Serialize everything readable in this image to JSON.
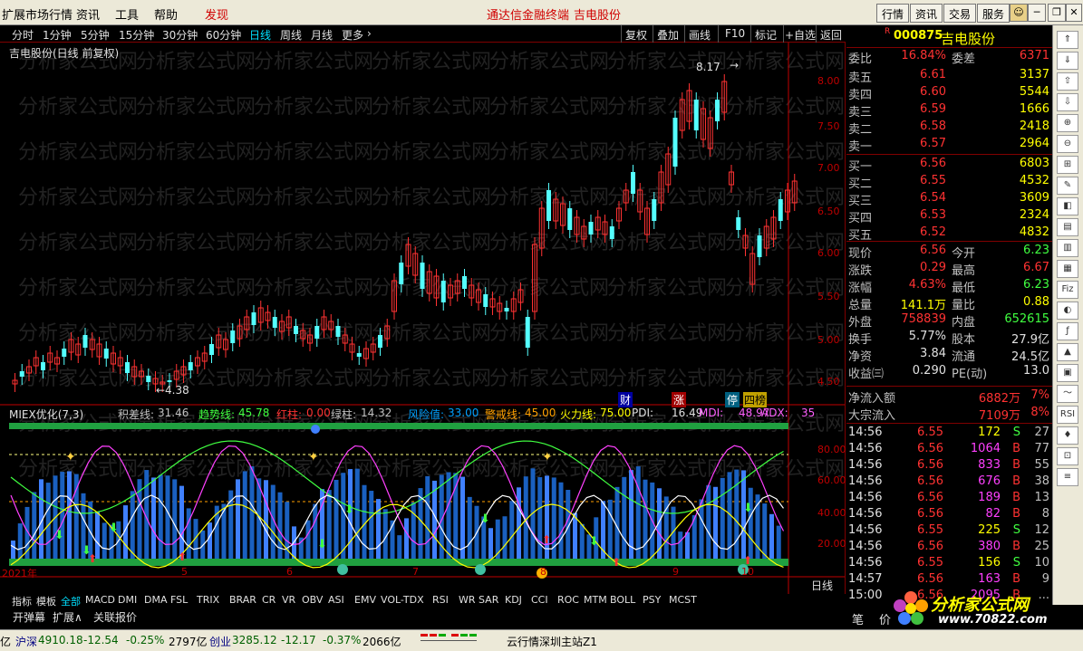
{
  "menu": {
    "items": [
      "扩展市场行情",
      "资讯",
      "工具",
      "帮助",
      "发现"
    ],
    "center": [
      "通达信金融终端",
      "吉电股份"
    ],
    "right_buttons": [
      "行情",
      "资讯",
      "交易",
      "服务"
    ]
  },
  "periods": [
    "分时",
    "1分钟",
    "5分钟",
    "15分钟",
    "30分钟",
    "60分钟",
    "日线",
    "周线",
    "月线",
    "更多"
  ],
  "tools": [
    "复权",
    "叠加",
    "画线",
    "F10",
    "标记",
    "+自选",
    "返回"
  ],
  "chart_title": "吉电股份(日线 前复权)",
  "price_axis": [
    "8.00",
    "7.50",
    "7.00",
    "6.50",
    "6.00",
    "5.50",
    "5.00",
    "4.50"
  ],
  "high_label": "8.17",
  "low_label": "4.38",
  "event_badges": [
    "财",
    "涨",
    "停",
    "四榜"
  ],
  "indicator": {
    "name": "MIEX优化(7,3)",
    "params": [
      {
        "label": "积差线:",
        "value": "31.46"
      },
      {
        "label": "趋势线:",
        "value": "45.78"
      },
      {
        "label": "红柱:",
        "value": "0.00"
      },
      {
        "label": "绿柱:",
        "value": "14.32"
      },
      {
        "label": "风险值:",
        "value": "33.00"
      },
      {
        "label": "警戒线:",
        "value": "45.00"
      },
      {
        "label": "火力线:",
        "value": "75.00"
      },
      {
        "label": "PDI:",
        "value": "16.49"
      },
      {
        "label": "MDI:",
        "value": "48.97"
      },
      {
        "label": "ADX:",
        "value": "35"
      }
    ],
    "axis": [
      "80.00",
      "60.00",
      "40.00",
      "20.00"
    ]
  },
  "date_axis": [
    "2021年",
    "5",
    "6",
    "7",
    "8",
    "9",
    "10"
  ],
  "period_label": "日线",
  "zoom": [
    "+",
    "-",
    "0"
  ],
  "indicator_tabs": [
    "指标",
    "模板",
    "全部",
    "MACD",
    "DMI",
    "DMA",
    "FSL",
    "TRIX",
    "BRAR",
    "CR",
    "VR",
    "OBV",
    "ASI",
    "EMV",
    "VOL-TDX",
    "RSI",
    "WR",
    "SAR",
    "KDJ",
    "CCI",
    "ROC",
    "MTM",
    "BOLL",
    "PSY",
    "MCST"
  ],
  "sub_tabs": [
    "开弹幕",
    "扩展∧",
    "关联报价"
  ],
  "quote": {
    "code": "000875",
    "name": "吉电股份",
    "webi_label": "委比",
    "webi": "16.84%",
    "weicha_label": "委差",
    "weicha": "6371",
    "sells": [
      {
        "l": "卖五",
        "p": "6.61",
        "v": "3137"
      },
      {
        "l": "卖四",
        "p": "6.60",
        "v": "5544"
      },
      {
        "l": "卖三",
        "p": "6.59",
        "v": "1666"
      },
      {
        "l": "卖二",
        "p": "6.58",
        "v": "2418"
      },
      {
        "l": "卖一",
        "p": "6.57",
        "v": "2964"
      }
    ],
    "buys": [
      {
        "l": "买一",
        "p": "6.56",
        "v": "6803"
      },
      {
        "l": "买二",
        "p": "6.55",
        "v": "4532"
      },
      {
        "l": "买三",
        "p": "6.54",
        "v": "3609"
      },
      {
        "l": "买四",
        "p": "6.53",
        "v": "2324"
      },
      {
        "l": "买五",
        "p": "6.52",
        "v": "4832"
      }
    ],
    "stats": [
      {
        "a": "现价",
        "av": "6.56",
        "b": "今开",
        "bv": "6.23"
      },
      {
        "a": "涨跌",
        "av": "0.29",
        "b": "最高",
        "bv": "6.67"
      },
      {
        "a": "涨幅",
        "av": "4.63%",
        "b": "最低",
        "bv": "6.23"
      },
      {
        "a": "总量",
        "av": "141.1万",
        "b": "量比",
        "bv": "0.88"
      },
      {
        "a": "外盘",
        "av": "758839",
        "b": "内盘",
        "bv": "652615"
      },
      {
        "a": "换手",
        "av": "5.77%",
        "b": "股本",
        "bv": "27.9亿"
      },
      {
        "a": "净资",
        "av": "3.84",
        "b": "流通",
        "bv": "24.5亿"
      },
      {
        "a": "收益㈢",
        "av": "0.290",
        "b": "PE(动)",
        "bv": "13.0"
      }
    ],
    "flows": [
      {
        "l": "净流入额",
        "v": "6882万",
        "p": "7%"
      },
      {
        "l": "大宗流入",
        "v": "7109万",
        "p": "8%"
      }
    ],
    "ticks": [
      {
        "t": "14:56",
        "p": "6.55",
        "v": "172",
        "s": "S",
        "n": "27"
      },
      {
        "t": "14:56",
        "p": "6.56",
        "v": "1064",
        "s": "B",
        "n": "77"
      },
      {
        "t": "14:56",
        "p": "6.56",
        "v": "833",
        "s": "B",
        "n": "55"
      },
      {
        "t": "14:56",
        "p": "6.56",
        "v": "676",
        "s": "B",
        "n": "38"
      },
      {
        "t": "14:56",
        "p": "6.56",
        "v": "189",
        "s": "B",
        "n": "13"
      },
      {
        "t": "14:56",
        "p": "6.56",
        "v": "82",
        "s": "B",
        "n": "8"
      },
      {
        "t": "14:56",
        "p": "6.55",
        "v": "225",
        "s": "S",
        "n": "12"
      },
      {
        "t": "14:56",
        "p": "6.56",
        "v": "380",
        "s": "B",
        "n": "25"
      },
      {
        "t": "14:56",
        "p": "6.55",
        "v": "156",
        "s": "S",
        "n": "10"
      },
      {
        "t": "14:57",
        "p": "6.56",
        "v": "163",
        "s": "B",
        "n": "9"
      },
      {
        "t": "15:00",
        "p": "6.56",
        "v": "2095",
        "s": "B",
        "n": "..."
      }
    ],
    "bottom_tab": "笔",
    "bottom_tab2": "价"
  },
  "watermark": "分析家公式网",
  "logo": {
    "brand": "分析家公式网",
    "url": "www.70822.com"
  },
  "status": {
    "sh_label": "沪深",
    "sh_val": "4910.18",
    "sh_chg": "-12.54",
    "sh_pct": "-0.25%",
    "sh_amt": "2797亿",
    "cy_label": "创业",
    "cy_val": "3285.12",
    "cy_chg": "-12.17",
    "cy_pct": "-0.37%",
    "cy_amt": "2066亿",
    "server": "云行情深圳主站Z1",
    "yi": "亿"
  },
  "colors": {
    "up": "#ff3232",
    "down": "#54ffff",
    "bg": "#000000",
    "axis": "#c00000"
  }
}
